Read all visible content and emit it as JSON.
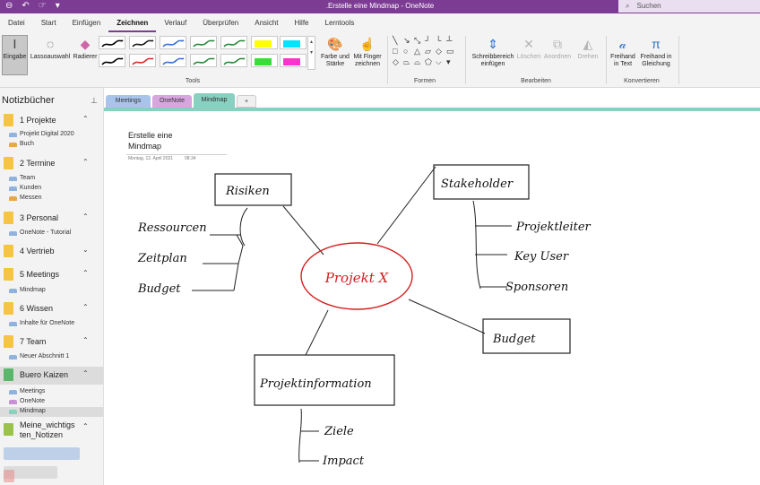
{
  "titlebar": {
    "title": ".Erstelle eine Mindmap  -  OneNote",
    "search_label": "Suchen",
    "colors": {
      "accent": "#7d3c94"
    }
  },
  "menu_tabs": [
    "Datei",
    "Start",
    "Einfügen",
    "Zeichnen",
    "Verlauf",
    "Überprüfen",
    "Ansicht",
    "Hilfe",
    "Lerntools"
  ],
  "menu_active": "Zeichnen",
  "ribbon": {
    "eingabe": "Eingabe",
    "lasso": "Lassoauswahl",
    "radierer": "Radierer",
    "farbe_line1": "Farbe und",
    "farbe_line2": "Stärke",
    "finger_line1": "Mit Finger",
    "finger_line2": "zeichnen",
    "tools_label": "Tools",
    "formen_label": "Formen",
    "schreib_line1": "Schreibbereich",
    "schreib_line2": "einfügen",
    "loeschen": "Löschen",
    "anordnen": "Anordnen",
    "drehen": "Drehen",
    "bearbeiten_label": "Bearbeiten",
    "freihand_text_line1": "Freihand",
    "freihand_text_line2": "in Text",
    "freihand_gl_line1": "Freihand in",
    "freihand_gl_line2": "Gleichung",
    "konvertieren_label": "Konvertieren",
    "pen_colors_row1": [
      "#000000",
      "#1a1a1a",
      "#3b6fd1",
      "#2a8a3a",
      "#2a8a3a",
      "#ffff00",
      "#00e5ff"
    ],
    "pen_colors_row2": [
      "#000000",
      "#d92b2b",
      "#3b6fd1",
      "#2a8a3a",
      "#2a8a3a",
      "#33e033",
      "#ff33cc"
    ]
  },
  "sidebar": {
    "header": "Notizbücher",
    "notebooks": [
      {
        "name": "1 Projekte",
        "color": "#f5c542",
        "sections": [
          "Projekt Digital 2020",
          "Buch"
        ]
      },
      {
        "name": "2 Termine",
        "color": "#f5c542",
        "sections": [
          "Team",
          "Kunden",
          "Messen"
        ]
      },
      {
        "name": "3 Personal",
        "color": "#f5c542",
        "sections": [
          "OneNote - Tutorial"
        ]
      },
      {
        "name": "4 Vertrieb",
        "color": "#f5c542",
        "sections": []
      },
      {
        "name": "5 Meetings",
        "color": "#f5c542",
        "sections": [
          "Mindmap"
        ]
      },
      {
        "name": "6 Wissen",
        "color": "#f5c542",
        "sections": [
          "Inhalte für OneNote"
        ]
      },
      {
        "name": "7 Team",
        "color": "#f5c542",
        "sections": [
          "Neuer Abschnitt 1"
        ]
      },
      {
        "name": "Buero Kaizen",
        "color": "#5bb56a",
        "sections": [
          "Meetings",
          "OneNote",
          "Mindmap"
        ]
      },
      {
        "name_line1": "Meine_wichtigs",
        "name_line2": "ten_Notizen",
        "color": "#9bc34a"
      }
    ]
  },
  "section_tabs": [
    {
      "label": "Meetings",
      "color": "#a9c4ea"
    },
    {
      "label": "OneNote",
      "color": "#d7a6df"
    },
    {
      "label": "Mindmap",
      "color": "#88d0c0"
    }
  ],
  "add_tab": "+",
  "page": {
    "title_line1": "Erstelle eine",
    "title_line2": "Mindmap",
    "date": "Montag, 12. April 2021",
    "time": "08:34"
  },
  "mindmap": {
    "center": "Projekt X",
    "risiken": "Risiken",
    "risiken_items": [
      "Ressourcen",
      "Zeitplan",
      "Budget"
    ],
    "stakeholder": "Stakeholder",
    "stakeholder_items": [
      "Projektleiter",
      "Key User",
      "Sponsoren"
    ],
    "budget": "Budget",
    "projektinfo": "Projektinformation",
    "projektinfo_items": [
      "Ziele",
      "Impact"
    ]
  }
}
